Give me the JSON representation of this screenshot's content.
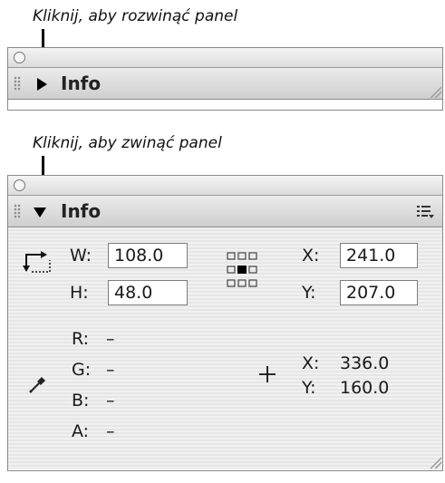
{
  "captions": {
    "expand": "Kliknij, aby rozwinąć panel",
    "collapse": "Kliknij, aby zwinąć panel"
  },
  "collapsed_panel": {
    "title": "Info",
    "state": "collapsed"
  },
  "expanded_panel": {
    "title": "Info",
    "state": "expanded",
    "size": {
      "w_label": "W:",
      "w_value": "108.0",
      "h_label": "H:",
      "h_value": "48.0"
    },
    "position": {
      "x_label": "X:",
      "x_value": "241.0",
      "y_label": "Y:",
      "y_value": "207.0"
    },
    "color": {
      "r_label": "R:",
      "r_value": "–",
      "g_label": "G:",
      "g_value": "–",
      "b_label": "B:",
      "b_value": "–",
      "a_label": "A:",
      "a_value": "–"
    },
    "cursor": {
      "x_label": "X:",
      "x_value": "336.0",
      "y_label": "Y:",
      "y_value": "160.0"
    }
  },
  "icons": {
    "collapse_toggle": "triangle-right-icon",
    "expand_toggle": "triangle-down-icon",
    "options": "panel-menu-icon",
    "registration": "registration-point-grid-icon",
    "eyedropper": "eyedropper-icon",
    "crosshair": "crosshair-icon"
  }
}
